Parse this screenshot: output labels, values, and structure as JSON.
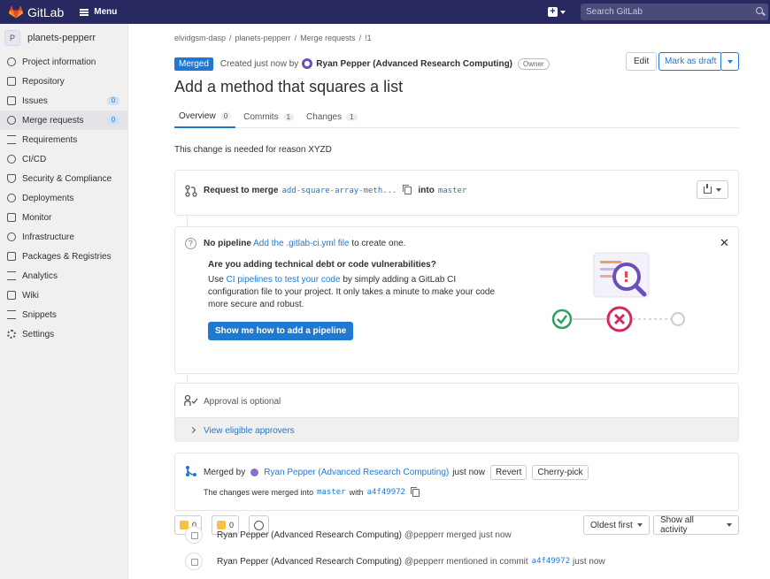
{
  "app": {
    "name": "GitLab",
    "menu_label": "Menu",
    "search_placeholder": "Search GitLab"
  },
  "sidebar": {
    "project_initial": "P",
    "project_name": "planets-pepperr",
    "items": [
      {
        "label": "Project information",
        "icon": "info-icon"
      },
      {
        "label": "Repository",
        "icon": "book-icon"
      },
      {
        "label": "Issues",
        "icon": "issues-icon",
        "badge": "0"
      },
      {
        "label": "Merge requests",
        "icon": "merge-request-icon",
        "badge": "0",
        "active": true
      },
      {
        "label": "Requirements",
        "icon": "requirements-icon"
      },
      {
        "label": "CI/CD",
        "icon": "rocket-icon"
      },
      {
        "label": "Security & Compliance",
        "icon": "shield-icon"
      },
      {
        "label": "Deployments",
        "icon": "deployments-icon"
      },
      {
        "label": "Monitor",
        "icon": "monitor-icon"
      },
      {
        "label": "Infrastructure",
        "icon": "cloud-icon"
      },
      {
        "label": "Packages & Registries",
        "icon": "package-icon"
      },
      {
        "label": "Analytics",
        "icon": "chart-icon"
      },
      {
        "label": "Wiki",
        "icon": "book-icon"
      },
      {
        "label": "Snippets",
        "icon": "snippet-icon"
      },
      {
        "label": "Settings",
        "icon": "gear-icon"
      }
    ]
  },
  "breadcrumb": [
    "elvidgsm-dasp",
    "/",
    "planets-pepperr",
    "/",
    "Merge requests",
    "/",
    "!1"
  ],
  "header": {
    "status": "Merged",
    "created_text": "Created just now by",
    "author": "Ryan Pepper (Advanced Research Computing)",
    "role": "Owner",
    "edit_label": "Edit",
    "draft_label": "Mark as draft"
  },
  "title": "Add a method that squares a list",
  "tabs": [
    {
      "label": "Overview",
      "count": "0"
    },
    {
      "label": "Commits",
      "count": "1"
    },
    {
      "label": "Changes",
      "count": "1"
    }
  ],
  "description": "This change is needed for reason XYZD",
  "request": {
    "prefix": "Request to merge",
    "source": "add-square-array-meth...",
    "into": "into",
    "target": "master"
  },
  "pipeline": {
    "no_pipeline": "No pipeline",
    "add_link": "Add the .gitlab-ci.yml file",
    "suffix": "to create one.",
    "tip_title": "Are you adding technical debt or code vulnerabilities?",
    "tip_use": "Use",
    "tip_link": "CI pipelines to test your code",
    "tip_rest": "by simply adding a GitLab CI configuration file to your project. It only takes a minute to make your code more secure and robust.",
    "cta": "Show me how to add a pipeline"
  },
  "approval": {
    "text": "Approval is optional",
    "link": "View eligible approvers"
  },
  "merged": {
    "prefix": "Merged by",
    "author": "Ryan Pepper (Advanced Research Computing)",
    "when": "just now",
    "revert": "Revert",
    "cherry": "Cherry-pick",
    "sub_prefix": "The changes were merged into",
    "branch": "master",
    "with": "with",
    "sha": "a4f49972"
  },
  "awards": {
    "thumbs_up": "0",
    "thumbs_down": "0"
  },
  "sort": {
    "order": "Oldest first",
    "filter": "Show all activity"
  },
  "activity": [
    {
      "author": "Ryan Pepper (Advanced Research Computing)",
      "text": "@pepperr merged just now"
    },
    {
      "author": "Ryan Pepper (Advanced Research Computing)",
      "text": "@pepperr mentioned in commit",
      "sha": "a4f49972",
      "when": "just now"
    }
  ],
  "colors": {
    "topbar": "#292961",
    "primary": "#1f78d1",
    "success": "#108548",
    "danger": "#dd2b0e"
  }
}
